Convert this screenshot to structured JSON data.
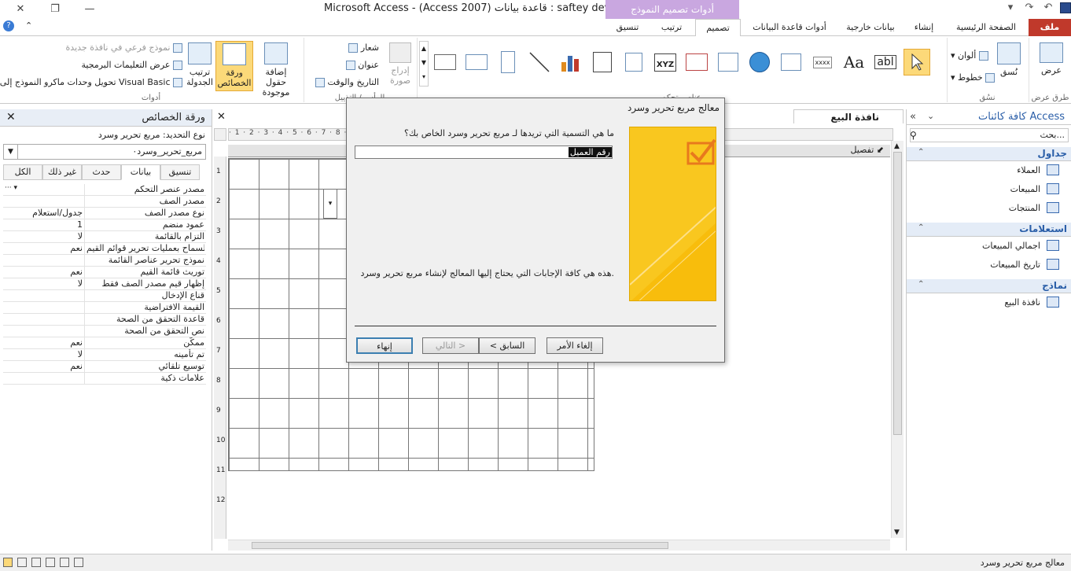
{
  "window": {
    "title": "Microsoft Access  -  (Access 2007) قاعدة بيانات : saftey devices-",
    "context_title": "أدوات تصميم النموذج"
  },
  "titlebar_buttons": {
    "close": "✕",
    "restore": "❐",
    "minimize": "—"
  },
  "tabs": {
    "file": "ملف",
    "home": "الصفحة الرئيسية",
    "create": "إنشاء",
    "external": "بيانات خارجية",
    "db_tools": "أدوات قاعدة البيانات",
    "design": "تصميم",
    "arrange": "ترتيب",
    "format": "تنسيق"
  },
  "ribbon": {
    "views_label": "عرض",
    "views_group": "طرق عرض",
    "themes_label": "نُسق",
    "colors": "ألوان",
    "fonts": "خطوط",
    "themes_group": "نسُق",
    "controls_group": "عناصر تحكم",
    "insert_image": "إدراج صورة",
    "logo": "شعار",
    "title": "عنوان",
    "date_time": "التاريخ والوقت",
    "header_group": "الرأس / التذييل",
    "add_fields": "إضافة حقول موجودة",
    "property_sheet": "ورقة الخصائص",
    "tab_order": "ترتيب الجدولة",
    "subform_new_window": "نموذج فرعي في نافذة جديدة",
    "view_code": "عرض التعليمات البرمجية",
    "convert_macros": "تحويل وحدات ماكرو النموذج إلى Visual Basic",
    "tools_group": "أدوات"
  },
  "property_sheet": {
    "title": "ورقة الخصائص",
    "selection_type": "نوع التحديد:  مربع تحرير وسرد",
    "selected_object": "مربع_تحرير_وسرد٠",
    "tabs": [
      "تنسيق",
      "بيانات",
      "حدث",
      "غير ذلك",
      "الكل"
    ],
    "rows": [
      {
        "k": "مصدر عنصر التحكم",
        "v": ""
      },
      {
        "k": "مصدر الصف",
        "v": ""
      },
      {
        "k": "نوع مصدر الصف",
        "v": "جدول/استعلام"
      },
      {
        "k": "عمود منضم",
        "v": "1"
      },
      {
        "k": "التزام بالقائمة",
        "v": "لا"
      },
      {
        "k": "السماح بعمليات تحرير قوائم القيم",
        "v": "نعم"
      },
      {
        "k": "نموذج تحرير عناصر القائمة",
        "v": ""
      },
      {
        "k": "توريث قائمة القيم",
        "v": "نعم"
      },
      {
        "k": "إظهار قيم مصدر الصف فقط",
        "v": "لا"
      },
      {
        "k": "قناع الإدخال",
        "v": ""
      },
      {
        "k": "القيمة الافتراضية",
        "v": ""
      },
      {
        "k": "قاعدة التحقق من الصحة",
        "v": ""
      },
      {
        "k": "نص التحقق من الصحة",
        "v": ""
      },
      {
        "k": "ممكّن",
        "v": "نعم"
      },
      {
        "k": "تم تأمينه",
        "v": "لا"
      },
      {
        "k": "توسيع تلقائي",
        "v": "نعم"
      },
      {
        "k": "علامات ذكية",
        "v": ""
      }
    ]
  },
  "design": {
    "doc_tab": "نافذة البيع",
    "section": "تفصيل",
    "ruler_h": "· 1 · 2 · 3 · 4 · 5 · 6 · 7 · 8 · 9 · 10 · 11 · 12 · 13 · 14 · 15 · 16 · 17 · 18 · 19 · 20 · 21 · 22 ·",
    "ruler_v": [
      "1",
      "2",
      "3",
      "4",
      "5",
      "6",
      "7",
      "8",
      "9",
      "10",
      "11",
      "12"
    ]
  },
  "nav": {
    "title": "كافة كائنات Access",
    "search_placeholder": "بحث...",
    "groups": [
      {
        "name": "جداول",
        "items": [
          "العملاء",
          "المبيعات",
          "المنتجات"
        ]
      },
      {
        "name": "استعلامات",
        "items": [
          "اجمالي المبيعات",
          "تاريخ المبيعات"
        ]
      },
      {
        "name": "نماذج",
        "items": [
          "نافذة البيع"
        ]
      }
    ]
  },
  "dialog": {
    "title": "معالج مربع تحرير وسرد",
    "question": "ما هي التسمية التي تريدها لـ مربع تحرير وسرد الخاص بك؟",
    "input_value": "رقم العميل",
    "note": "هذه هي كافة الإجابات التي يحتاج إليها المعالج لإنشاء مربع تحرير وسرد.",
    "cancel": "إلغاء الأمر",
    "back": "< السابق",
    "next": "التالي >",
    "finish": "إنهاء"
  },
  "status": {
    "text": "معالج مربع تحرير وسرد"
  }
}
